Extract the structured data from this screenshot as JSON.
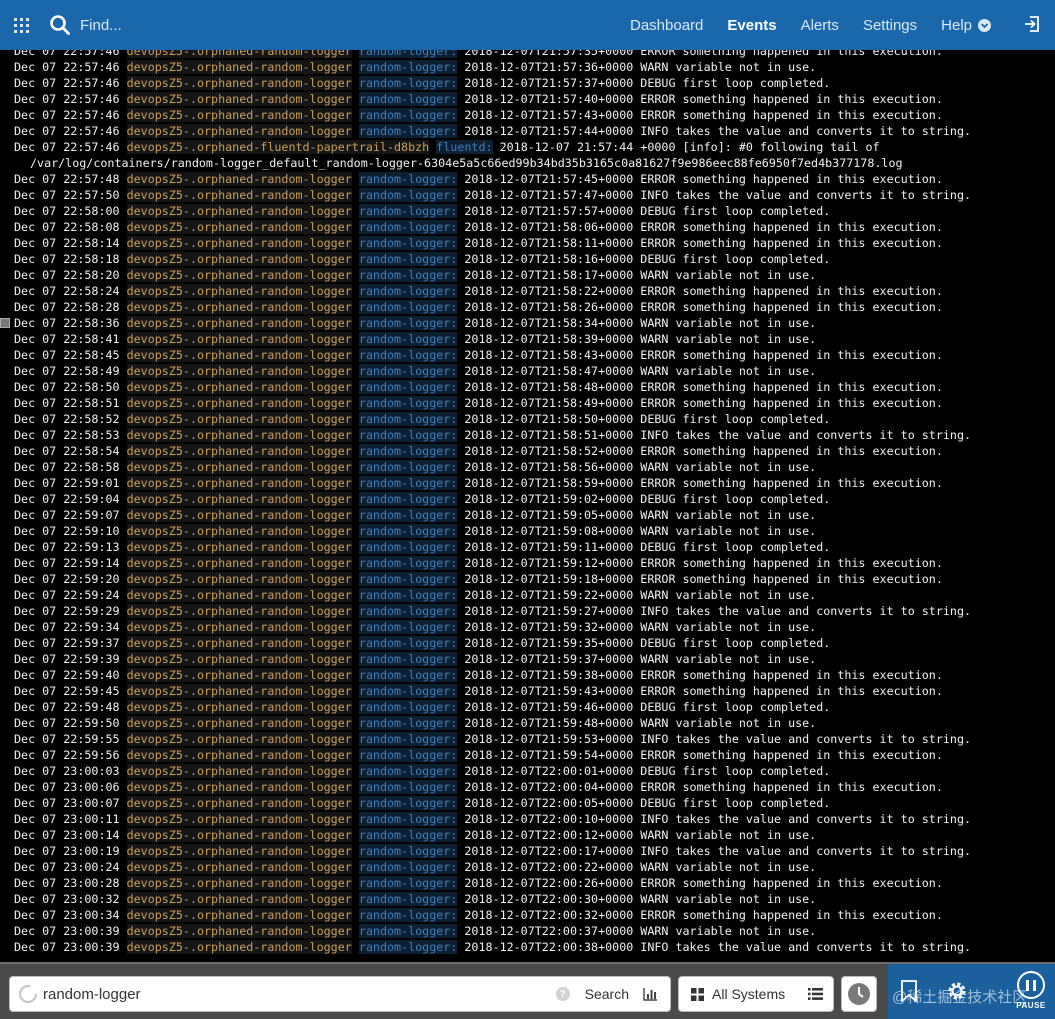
{
  "topbar": {
    "find_placeholder": "Find...",
    "nav": [
      {
        "label": "Dashboard",
        "active": false
      },
      {
        "label": "Events",
        "active": true
      },
      {
        "label": "Alerts",
        "active": false
      },
      {
        "label": "Settings",
        "active": false
      }
    ],
    "help_label": "Help"
  },
  "log": {
    "first_rows": [
      {
        "ts": "Dec 07 22:57:46",
        "sys": "devopsZ5-.orphaned-random-logger",
        "prog": "random-logger:",
        "msg": "2018-12-07T21:57:35+0000 ERROR something happened in this execution."
      },
      {
        "ts": "Dec 07 22:57:46",
        "sys": "devopsZ5-.orphaned-random-logger",
        "prog": "random-logger:",
        "msg": "2018-12-07T21:57:36+0000 WARN variable not in use."
      },
      {
        "ts": "Dec 07 22:57:46",
        "sys": "devopsZ5-.orphaned-random-logger",
        "prog": "random-logger:",
        "msg": "2018-12-07T21:57:37+0000 DEBUG first loop completed."
      },
      {
        "ts": "Dec 07 22:57:46",
        "sys": "devopsZ5-.orphaned-random-logger",
        "prog": "random-logger:",
        "msg": "2018-12-07T21:57:40+0000 ERROR something happened in this execution."
      },
      {
        "ts": "Dec 07 22:57:46",
        "sys": "devopsZ5-.orphaned-random-logger",
        "prog": "random-logger:",
        "msg": "2018-12-07T21:57:43+0000 ERROR something happened in this execution."
      },
      {
        "ts": "Dec 07 22:57:46",
        "sys": "devopsZ5-.orphaned-random-logger",
        "prog": "random-logger:",
        "msg": "2018-12-07T21:57:44+0000 INFO takes the value and converts it to string."
      }
    ],
    "fluentd_row": {
      "ts": "Dec 07 22:57:46",
      "sys": "devopsZ5-.orphaned-fluentd-papertrail-d8bzh",
      "prog": "fluentd:",
      "msg": "2018-12-07 21:57:44 +0000 [info]: #0 following tail of",
      "wrap": "/var/log/containers/random-logger_default_random-logger-6304e5a5c66ed99b34bd35b3165c0a81627f9e986eec88fe6950f7ed4b377178.log"
    },
    "rows": [
      {
        "ts": "Dec 07 22:57:48",
        "sys": "devopsZ5-.orphaned-random-logger",
        "prog": "random-logger:",
        "msg": "2018-12-07T21:57:45+0000 ERROR something happened in this execution."
      },
      {
        "ts": "Dec 07 22:57:50",
        "sys": "devopsZ5-.orphaned-random-logger",
        "prog": "random-logger:",
        "msg": "2018-12-07T21:57:47+0000 INFO takes the value and converts it to string."
      },
      {
        "ts": "Dec 07 22:58:00",
        "sys": "devopsZ5-.orphaned-random-logger",
        "prog": "random-logger:",
        "msg": "2018-12-07T21:57:57+0000 DEBUG first loop completed."
      },
      {
        "ts": "Dec 07 22:58:08",
        "sys": "devopsZ5-.orphaned-random-logger",
        "prog": "random-logger:",
        "msg": "2018-12-07T21:58:06+0000 ERROR something happened in this execution."
      },
      {
        "ts": "Dec 07 22:58:14",
        "sys": "devopsZ5-.orphaned-random-logger",
        "prog": "random-logger:",
        "msg": "2018-12-07T21:58:11+0000 ERROR something happened in this execution."
      },
      {
        "ts": "Dec 07 22:58:18",
        "sys": "devopsZ5-.orphaned-random-logger",
        "prog": "random-logger:",
        "msg": "2018-12-07T21:58:16+0000 DEBUG first loop completed."
      },
      {
        "ts": "Dec 07 22:58:20",
        "sys": "devopsZ5-.orphaned-random-logger",
        "prog": "random-logger:",
        "msg": "2018-12-07T21:58:17+0000 WARN variable not in use."
      },
      {
        "ts": "Dec 07 22:58:24",
        "sys": "devopsZ5-.orphaned-random-logger",
        "prog": "random-logger:",
        "msg": "2018-12-07T21:58:22+0000 ERROR something happened in this execution."
      },
      {
        "ts": "Dec 07 22:58:28",
        "sys": "devopsZ5-.orphaned-random-logger",
        "prog": "random-logger:",
        "msg": "2018-12-07T21:58:26+0000 ERROR something happened in this execution."
      },
      {
        "ts": "Dec 07 22:58:36",
        "sys": "devopsZ5-.orphaned-random-logger",
        "prog": "random-logger:",
        "msg": "2018-12-07T21:58:34+0000 WARN variable not in use."
      },
      {
        "ts": "Dec 07 22:58:41",
        "sys": "devopsZ5-.orphaned-random-logger",
        "prog": "random-logger:",
        "msg": "2018-12-07T21:58:39+0000 WARN variable not in use."
      },
      {
        "ts": "Dec 07 22:58:45",
        "sys": "devopsZ5-.orphaned-random-logger",
        "prog": "random-logger:",
        "msg": "2018-12-07T21:58:43+0000 ERROR something happened in this execution."
      },
      {
        "ts": "Dec 07 22:58:49",
        "sys": "devopsZ5-.orphaned-random-logger",
        "prog": "random-logger:",
        "msg": "2018-12-07T21:58:47+0000 WARN variable not in use."
      },
      {
        "ts": "Dec 07 22:58:50",
        "sys": "devopsZ5-.orphaned-random-logger",
        "prog": "random-logger:",
        "msg": "2018-12-07T21:58:48+0000 ERROR something happened in this execution."
      },
      {
        "ts": "Dec 07 22:58:51",
        "sys": "devopsZ5-.orphaned-random-logger",
        "prog": "random-logger:",
        "msg": "2018-12-07T21:58:49+0000 ERROR something happened in this execution."
      },
      {
        "ts": "Dec 07 22:58:52",
        "sys": "devopsZ5-.orphaned-random-logger",
        "prog": "random-logger:",
        "msg": "2018-12-07T21:58:50+0000 DEBUG first loop completed."
      },
      {
        "ts": "Dec 07 22:58:53",
        "sys": "devopsZ5-.orphaned-random-logger",
        "prog": "random-logger:",
        "msg": "2018-12-07T21:58:51+0000 INFO takes the value and converts it to string."
      },
      {
        "ts": "Dec 07 22:58:54",
        "sys": "devopsZ5-.orphaned-random-logger",
        "prog": "random-logger:",
        "msg": "2018-12-07T21:58:52+0000 ERROR something happened in this execution."
      },
      {
        "ts": "Dec 07 22:58:58",
        "sys": "devopsZ5-.orphaned-random-logger",
        "prog": "random-logger:",
        "msg": "2018-12-07T21:58:56+0000 WARN variable not in use."
      },
      {
        "ts": "Dec 07 22:59:01",
        "sys": "devopsZ5-.orphaned-random-logger",
        "prog": "random-logger:",
        "msg": "2018-12-07T21:58:59+0000 ERROR something happened in this execution."
      },
      {
        "ts": "Dec 07 22:59:04",
        "sys": "devopsZ5-.orphaned-random-logger",
        "prog": "random-logger:",
        "msg": "2018-12-07T21:59:02+0000 DEBUG first loop completed."
      },
      {
        "ts": "Dec 07 22:59:07",
        "sys": "devopsZ5-.orphaned-random-logger",
        "prog": "random-logger:",
        "msg": "2018-12-07T21:59:05+0000 WARN variable not in use."
      },
      {
        "ts": "Dec 07 22:59:10",
        "sys": "devopsZ5-.orphaned-random-logger",
        "prog": "random-logger:",
        "msg": "2018-12-07T21:59:08+0000 WARN variable not in use."
      },
      {
        "ts": "Dec 07 22:59:13",
        "sys": "devopsZ5-.orphaned-random-logger",
        "prog": "random-logger:",
        "msg": "2018-12-07T21:59:11+0000 DEBUG first loop completed."
      },
      {
        "ts": "Dec 07 22:59:14",
        "sys": "devopsZ5-.orphaned-random-logger",
        "prog": "random-logger:",
        "msg": "2018-12-07T21:59:12+0000 ERROR something happened in this execution."
      },
      {
        "ts": "Dec 07 22:59:20",
        "sys": "devopsZ5-.orphaned-random-logger",
        "prog": "random-logger:",
        "msg": "2018-12-07T21:59:18+0000 ERROR something happened in this execution."
      },
      {
        "ts": "Dec 07 22:59:24",
        "sys": "devopsZ5-.orphaned-random-logger",
        "prog": "random-logger:",
        "msg": "2018-12-07T21:59:22+0000 WARN variable not in use."
      },
      {
        "ts": "Dec 07 22:59:29",
        "sys": "devopsZ5-.orphaned-random-logger",
        "prog": "random-logger:",
        "msg": "2018-12-07T21:59:27+0000 INFO takes the value and converts it to string."
      },
      {
        "ts": "Dec 07 22:59:34",
        "sys": "devopsZ5-.orphaned-random-logger",
        "prog": "random-logger:",
        "msg": "2018-12-07T21:59:32+0000 WARN variable not in use."
      },
      {
        "ts": "Dec 07 22:59:37",
        "sys": "devopsZ5-.orphaned-random-logger",
        "prog": "random-logger:",
        "msg": "2018-12-07T21:59:35+0000 DEBUG first loop completed."
      },
      {
        "ts": "Dec 07 22:59:39",
        "sys": "devopsZ5-.orphaned-random-logger",
        "prog": "random-logger:",
        "msg": "2018-12-07T21:59:37+0000 WARN variable not in use."
      },
      {
        "ts": "Dec 07 22:59:40",
        "sys": "devopsZ5-.orphaned-random-logger",
        "prog": "random-logger:",
        "msg": "2018-12-07T21:59:38+0000 ERROR something happened in this execution."
      },
      {
        "ts": "Dec 07 22:59:45",
        "sys": "devopsZ5-.orphaned-random-logger",
        "prog": "random-logger:",
        "msg": "2018-12-07T21:59:43+0000 ERROR something happened in this execution."
      },
      {
        "ts": "Dec 07 22:59:48",
        "sys": "devopsZ5-.orphaned-random-logger",
        "prog": "random-logger:",
        "msg": "2018-12-07T21:59:46+0000 DEBUG first loop completed."
      },
      {
        "ts": "Dec 07 22:59:50",
        "sys": "devopsZ5-.orphaned-random-logger",
        "prog": "random-logger:",
        "msg": "2018-12-07T21:59:48+0000 WARN variable not in use."
      },
      {
        "ts": "Dec 07 22:59:55",
        "sys": "devopsZ5-.orphaned-random-logger",
        "prog": "random-logger:",
        "msg": "2018-12-07T21:59:53+0000 INFO takes the value and converts it to string."
      },
      {
        "ts": "Dec 07 22:59:56",
        "sys": "devopsZ5-.orphaned-random-logger",
        "prog": "random-logger:",
        "msg": "2018-12-07T21:59:54+0000 ERROR something happened in this execution."
      },
      {
        "ts": "Dec 07 23:00:03",
        "sys": "devopsZ5-.orphaned-random-logger",
        "prog": "random-logger:",
        "msg": "2018-12-07T22:00:01+0000 DEBUG first loop completed."
      },
      {
        "ts": "Dec 07 23:00:06",
        "sys": "devopsZ5-.orphaned-random-logger",
        "prog": "random-logger:",
        "msg": "2018-12-07T22:00:04+0000 ERROR something happened in this execution."
      },
      {
        "ts": "Dec 07 23:00:07",
        "sys": "devopsZ5-.orphaned-random-logger",
        "prog": "random-logger:",
        "msg": "2018-12-07T22:00:05+0000 DEBUG first loop completed."
      },
      {
        "ts": "Dec 07 23:00:11",
        "sys": "devopsZ5-.orphaned-random-logger",
        "prog": "random-logger:",
        "msg": "2018-12-07T22:00:10+0000 INFO takes the value and converts it to string."
      },
      {
        "ts": "Dec 07 23:00:14",
        "sys": "devopsZ5-.orphaned-random-logger",
        "prog": "random-logger:",
        "msg": "2018-12-07T22:00:12+0000 WARN variable not in use."
      },
      {
        "ts": "Dec 07 23:00:19",
        "sys": "devopsZ5-.orphaned-random-logger",
        "prog": "random-logger:",
        "msg": "2018-12-07T22:00:17+0000 INFO takes the value and converts it to string."
      },
      {
        "ts": "Dec 07 23:00:24",
        "sys": "devopsZ5-.orphaned-random-logger",
        "prog": "random-logger:",
        "msg": "2018-12-07T22:00:22+0000 WARN variable not in use."
      },
      {
        "ts": "Dec 07 23:00:28",
        "sys": "devopsZ5-.orphaned-random-logger",
        "prog": "random-logger:",
        "msg": "2018-12-07T22:00:26+0000 ERROR something happened in this execution."
      },
      {
        "ts": "Dec 07 23:00:32",
        "sys": "devopsZ5-.orphaned-random-logger",
        "prog": "random-logger:",
        "msg": "2018-12-07T22:00:30+0000 WARN variable not in use."
      },
      {
        "ts": "Dec 07 23:00:34",
        "sys": "devopsZ5-.orphaned-random-logger",
        "prog": "random-logger:",
        "msg": "2018-12-07T22:00:32+0000 ERROR something happened in this execution."
      },
      {
        "ts": "Dec 07 23:00:39",
        "sys": "devopsZ5-.orphaned-random-logger",
        "prog": "random-logger:",
        "msg": "2018-12-07T22:00:37+0000 WARN variable not in use."
      },
      {
        "ts": "Dec 07 23:00:39",
        "sys": "devopsZ5-.orphaned-random-logger",
        "prog": "random-logger:",
        "msg": "2018-12-07T22:00:38+0000 INFO takes the value and converts it to string."
      }
    ]
  },
  "bottombar": {
    "search_value": "random-logger",
    "help_glyph": "?",
    "search_label": "Search",
    "systems_label": "All Systems",
    "pause_label": "PAUSE",
    "watermark": "@稀土掘金技术社区"
  },
  "colors": {
    "topbar": "#1a67ac",
    "system_name": "#caa05c",
    "program_name": "#3d7fb8",
    "log_text": "#f2f2f2",
    "background": "#000000"
  },
  "icons": {
    "apps": "apps-grid-icon",
    "find": "search-icon",
    "help": "chevron-down-icon",
    "logout": "logout-icon",
    "loading": "loading-spinner-icon",
    "graph": "bar-chart-icon",
    "systems": "grid-icon",
    "list": "list-icon",
    "time": "clock-icon",
    "bookmark": "bookmark-icon",
    "settings": "gear-icon",
    "pause": "pause-icon"
  }
}
